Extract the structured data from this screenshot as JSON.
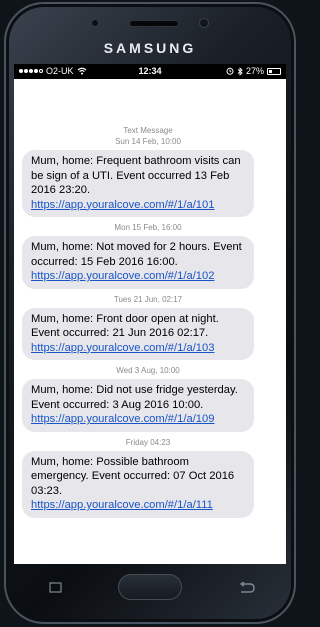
{
  "device": {
    "brand": "SAMSUNG"
  },
  "status_bar": {
    "carrier": "O2-UK",
    "time": "12:34",
    "battery": "27%",
    "signal_bars": 4,
    "signal_max": 5,
    "battery_level": 0.27
  },
  "thread": {
    "header": "Text Message",
    "messages": [
      {
        "timestamp": "Sun 14 Feb, 10:00",
        "text": "Mum, home: Frequent bathroom visits can be sign of a UTI. Event occurred 13 Feb 2016 23:20. ",
        "link": "https://app.youralcove.com/#/1/a/101"
      },
      {
        "timestamp": "Mon 15 Feb, 16:00",
        "text": "Mum, home: Not moved for 2 hours. Event occurred: 15 Feb 2016 16:00. ",
        "link": "https://app.youralcove.com/#/1/a/102"
      },
      {
        "timestamp": "Tues 21 Jun, 02:17",
        "text": "Mum, home: Front door open at night. Event occurred: 21 Jun 2016 02:17. ",
        "link": "https://app.youralcove.com/#/1/a/103"
      },
      {
        "timestamp": "Wed 3 Aug, 10:00",
        "text": "Mum, home: Did not use fridge yesterday. Event occurred: 3 Aug 2016 10:00. ",
        "link": "https://app.youralcove.com/#/1/a/109"
      },
      {
        "timestamp": "Friday 04:23",
        "text": "Mum, home: Possible bathroom emergency. Event occurred: 07 Oct 2016 03:23. ",
        "link": "https://app.youralcove.com/#/1/a/111"
      }
    ]
  },
  "colors": {
    "bubble": "#e6e6eb",
    "link": "#1a55c7",
    "timestamp": "#8a8a8f"
  },
  "icons": {
    "wifi": "wifi-icon",
    "alarm": "alarm-icon",
    "bluetooth": "bluetooth-icon",
    "battery": "battery-icon",
    "back": "back-arrow-icon",
    "recent": "recent-apps-icon"
  }
}
